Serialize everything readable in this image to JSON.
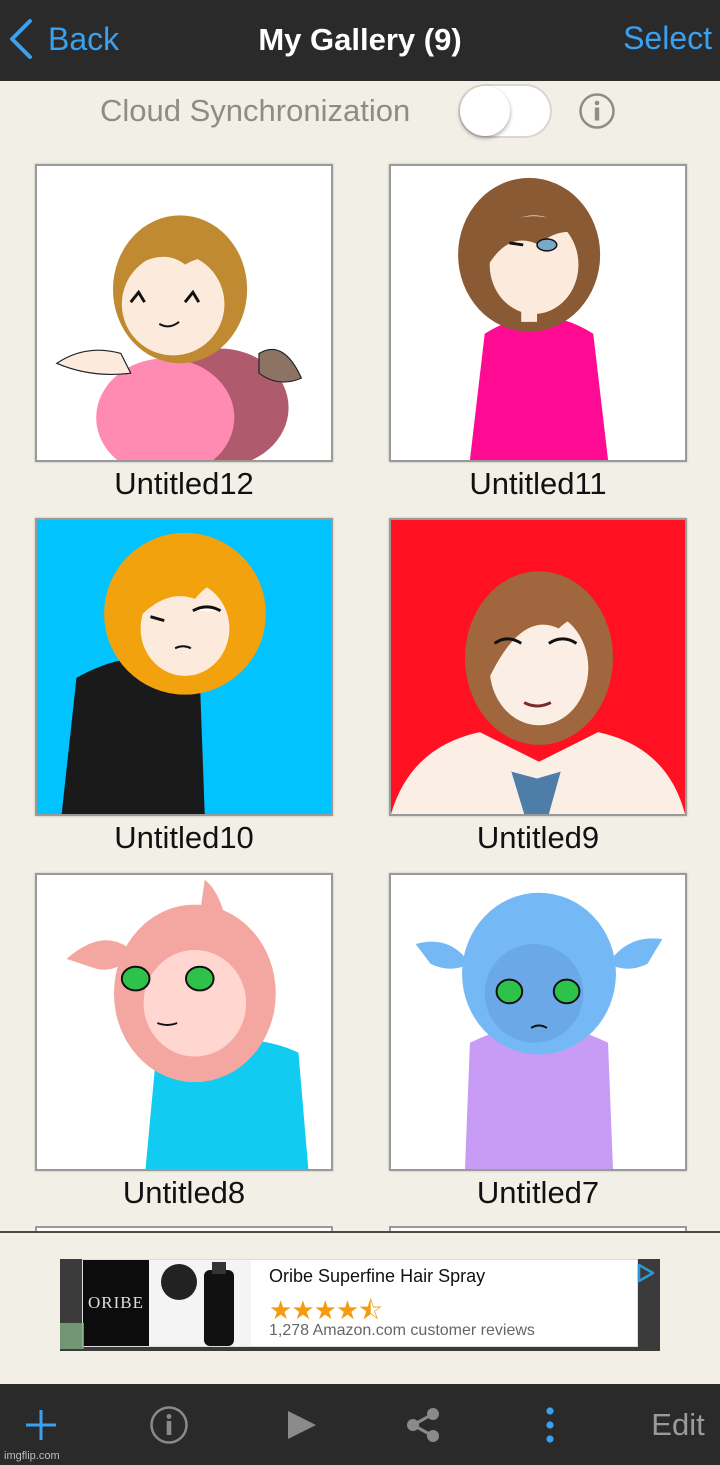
{
  "nav": {
    "back_label": "Back",
    "title": "My Gallery (9)",
    "select_label": "Select"
  },
  "sync": {
    "label": "Cloud Synchronization",
    "enabled": false
  },
  "gallery": {
    "items": [
      {
        "name": "Untitled12",
        "bg": "#ffffff"
      },
      {
        "name": "Untitled11",
        "bg": "#ffffff"
      },
      {
        "name": "Untitled10",
        "bg": "#00c3ff"
      },
      {
        "name": "Untitled9",
        "bg": "#ff1122"
      },
      {
        "name": "Untitled8",
        "bg": "#ffffff"
      },
      {
        "name": "Untitled7",
        "bg": "#ffffff"
      }
    ]
  },
  "ad": {
    "brand": "ORIBE",
    "product": "Oribe Superfine Hair Spray",
    "rating": 4.5,
    "stars": "★★★★⯪",
    "reviews": "1,278 Amazon.com customer reviews"
  },
  "toolbar": {
    "edit_label": "Edit",
    "icons": [
      "plus-icon",
      "info-icon",
      "play-icon",
      "share-icon",
      "more-icon"
    ]
  },
  "watermark": "imgflip.com",
  "colors": {
    "accent": "#3aa0f0",
    "bar": "#2a2a2a",
    "background": "#f2f0e6"
  }
}
